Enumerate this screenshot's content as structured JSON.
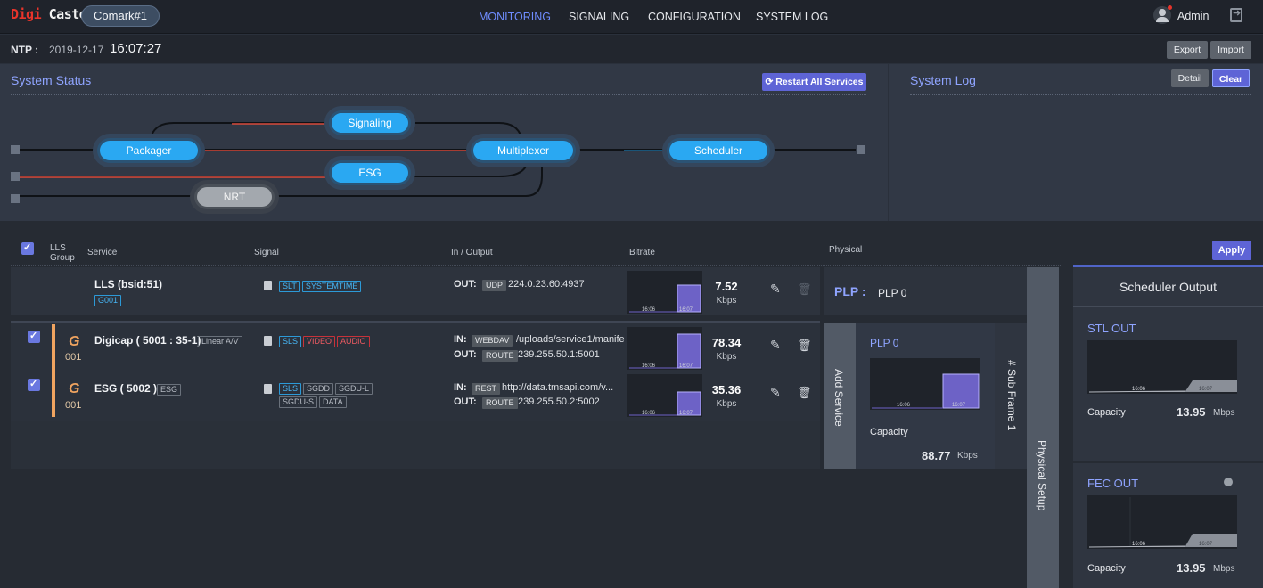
{
  "header": {
    "logo_part1": "Digi",
    "logo_part2": "Caster",
    "device": "Comark#1",
    "nav": [
      "MONITORING",
      "SIGNALING",
      "CONFIGURATION",
      "SYSTEM LOG"
    ],
    "user": "Admin"
  },
  "ntp": {
    "label": "NTP :",
    "date": "2019-12-17",
    "time": "16:07:27",
    "export": "Export",
    "import": "Import"
  },
  "status": {
    "title": "System Status",
    "restart": "Restart All Services",
    "nodes": {
      "signaling": "Signaling",
      "packager": "Packager",
      "multiplexer": "Multiplexer",
      "scheduler": "Scheduler",
      "esg": "ESG",
      "nrt": "NRT"
    }
  },
  "log": {
    "title": "System Log",
    "detail": "Detail",
    "clear": "Clear"
  },
  "table": {
    "headers": {
      "lls": "LLS",
      "group": "Group",
      "service": "Service",
      "signal": "Signal",
      "io": "In / Output",
      "bitrate": "Bitrate",
      "physical": "Physical"
    },
    "apply": "Apply",
    "lls_row": {
      "name": "LLS (bsid:51)",
      "group": "G001",
      "signals": [
        "SLT",
        "SYSTEMTIME"
      ],
      "out_label": "OUT:",
      "out_proto": "UDP",
      "out_addr": "224.0.23.60:4937",
      "bitrate": "7.52",
      "unit": "Kbps",
      "t1": "16:06",
      "t2": "16:07"
    },
    "rows": [
      {
        "g": "G",
        "gnum": "001",
        "name": "Digicap ( 5001 : 35-1)",
        "type": "Linear A/V",
        "signals": [
          "SLS",
          "VIDEO",
          "AUDIO"
        ],
        "in_label": "IN:",
        "in_proto": "WEBDAV",
        "in_addr": "/uploads/service1/manife",
        "out_label": "OUT:",
        "out_proto": "ROUTE",
        "out_addr": "239.255.50.1:5001",
        "bitrate": "78.34",
        "unit": "Kbps",
        "t1": "16:06",
        "t2": "16:07"
      },
      {
        "g": "G",
        "gnum": "001",
        "name": "ESG ( 5002 )",
        "type": "ESG",
        "signals": [
          "SLS",
          "SGDD",
          "SGDU-L",
          "SGDU-S",
          "DATA"
        ],
        "in_label": "IN:",
        "in_proto": "REST",
        "in_addr": "http://data.tmsapi.com/v...",
        "out_label": "OUT:",
        "out_proto": "ROUTE",
        "out_addr": "239.255.50.2:5002",
        "bitrate": "35.36",
        "unit": "Kbps",
        "t1": "16:06",
        "t2": "16:07"
      }
    ]
  },
  "physical": {
    "plp_label": "PLP :",
    "plp_value": "PLP 0",
    "add_service": "Add Service",
    "plp_box_title": "PLP 0",
    "t1": "16:06",
    "t2": "16:07",
    "capacity_label": "Capacity",
    "capacity_value": "88.77",
    "capacity_unit": "Kbps",
    "subframe": "# Sub Frame 1",
    "setup": "Physical Setup"
  },
  "scheduler": {
    "title": "Scheduler Output",
    "stl": {
      "label": "STL OUT",
      "capacity_label": "Capacity",
      "value": "13.95",
      "unit": "Mbps",
      "t1": "16:06",
      "t2": "16:07"
    },
    "fec": {
      "label": "FEC OUT",
      "capacity_label": "Capacity",
      "value": "13.95",
      "unit": "Mbps",
      "t1": "16:06",
      "t2": "16:07"
    }
  }
}
